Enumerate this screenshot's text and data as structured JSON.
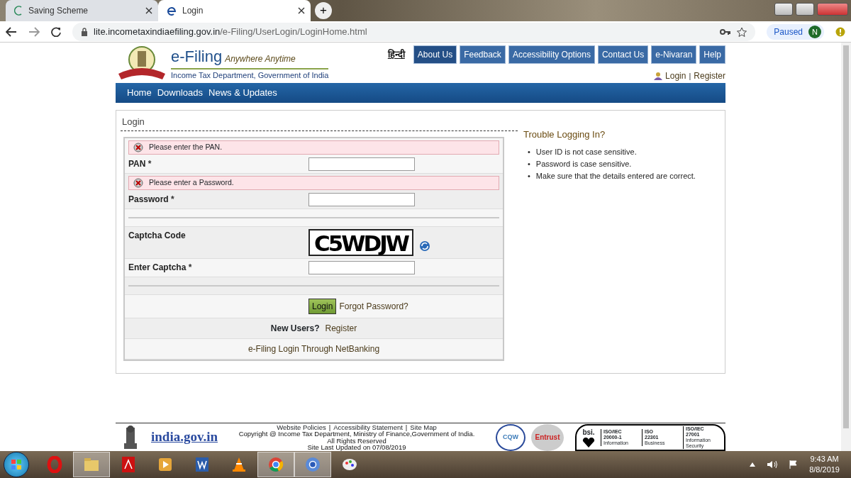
{
  "browser": {
    "tabs": [
      {
        "title": "Saving Scheme",
        "kind": "g",
        "selected": false
      },
      {
        "title": "Login",
        "kind": "e",
        "selected": true
      }
    ],
    "new_tab": "+",
    "url": {
      "host": "lite.incometaxindiaefiling.gov.in",
      "path": "/e-Filing/UserLogin/LoginHome.html"
    },
    "profile": {
      "status": "Paused",
      "initial": "N"
    }
  },
  "header": {
    "title": "e-Filing",
    "tagline": "Anywhere Anytime",
    "subtitle": "Income Tax Department, Government of India",
    "language": "हिन्दी",
    "top_links": [
      {
        "label": "About Us",
        "selected": true
      },
      {
        "label": "Feedback",
        "selected": false
      },
      {
        "label": "Accessibility Options",
        "selected": false
      },
      {
        "label": "Contact Us",
        "selected": false
      },
      {
        "label": "e-Nivaran",
        "selected": false
      },
      {
        "label": "Help",
        "selected": false
      }
    ],
    "account": {
      "login": "Login",
      "separator": "|",
      "register": "Register"
    }
  },
  "main_nav": [
    "Home",
    "Downloads",
    "News & Updates"
  ],
  "login": {
    "title": "Login",
    "rows": [
      {
        "kind": "field",
        "error": "Please enter the PAN.",
        "label": "PAN",
        "mark": "*"
      },
      {
        "kind": "field",
        "error": "Please enter a Password.",
        "label": "Password",
        "mark": "*"
      },
      {
        "kind": "divider"
      },
      {
        "kind": "captcha",
        "label": "Captcha Code",
        "code": "C5WDJW"
      },
      {
        "kind": "field",
        "label": "Enter Captcha",
        "mark": "*"
      },
      {
        "kind": "divider"
      },
      {
        "kind": "actions",
        "button": "Login",
        "link": "Forgot Password?"
      },
      {
        "kind": "register",
        "prompt": "New Users?",
        "link": "Register"
      },
      {
        "kind": "link",
        "text": "e-Filing Login Through NetBanking"
      }
    ]
  },
  "help": {
    "title": "Trouble Logging In?",
    "bullet": "•",
    "items": [
      "User ID is not case sensitive.",
      "Password is case sensitive.",
      "Make sure that the details entered are correct."
    ]
  },
  "footer": {
    "portal": "india.gov.in",
    "links": [
      "Website Policies",
      "Accessibility Statement",
      "Site Map"
    ],
    "separator": "|",
    "lines": [
      "Copyright @ Income Tax Department, Ministry of Finance,Government of India.",
      "All Rights Reserved",
      "Site Last Updated on 07/08/2019"
    ],
    "badges": [
      {
        "kind": "cqw",
        "text": "CQW"
      },
      {
        "kind": "entrust",
        "text": "Entrust"
      }
    ],
    "bsi": "bsi.",
    "certs": [
      {
        "standard": "ISO/IEC",
        "number": "20000-1",
        "area": "Information"
      },
      {
        "standard": "ISO",
        "number": "22301",
        "area": "Business"
      },
      {
        "standard": "ISO/IEC",
        "number": "27001",
        "area": "Information Security"
      }
    ]
  },
  "taskbar": {
    "apps": [
      {
        "kind": "opera",
        "open": false
      },
      {
        "kind": "explorer",
        "open": true
      },
      {
        "kind": "acrobat",
        "open": false
      },
      {
        "kind": "media",
        "open": false
      },
      {
        "kind": "word",
        "open": false
      },
      {
        "kind": "vlc",
        "open": false
      },
      {
        "kind": "chrome",
        "open": true
      },
      {
        "kind": "chrome-blue",
        "open": true
      },
      {
        "kind": "paint",
        "open": false
      }
    ],
    "time": "9:43 AM",
    "date": "8/8/2019"
  }
}
